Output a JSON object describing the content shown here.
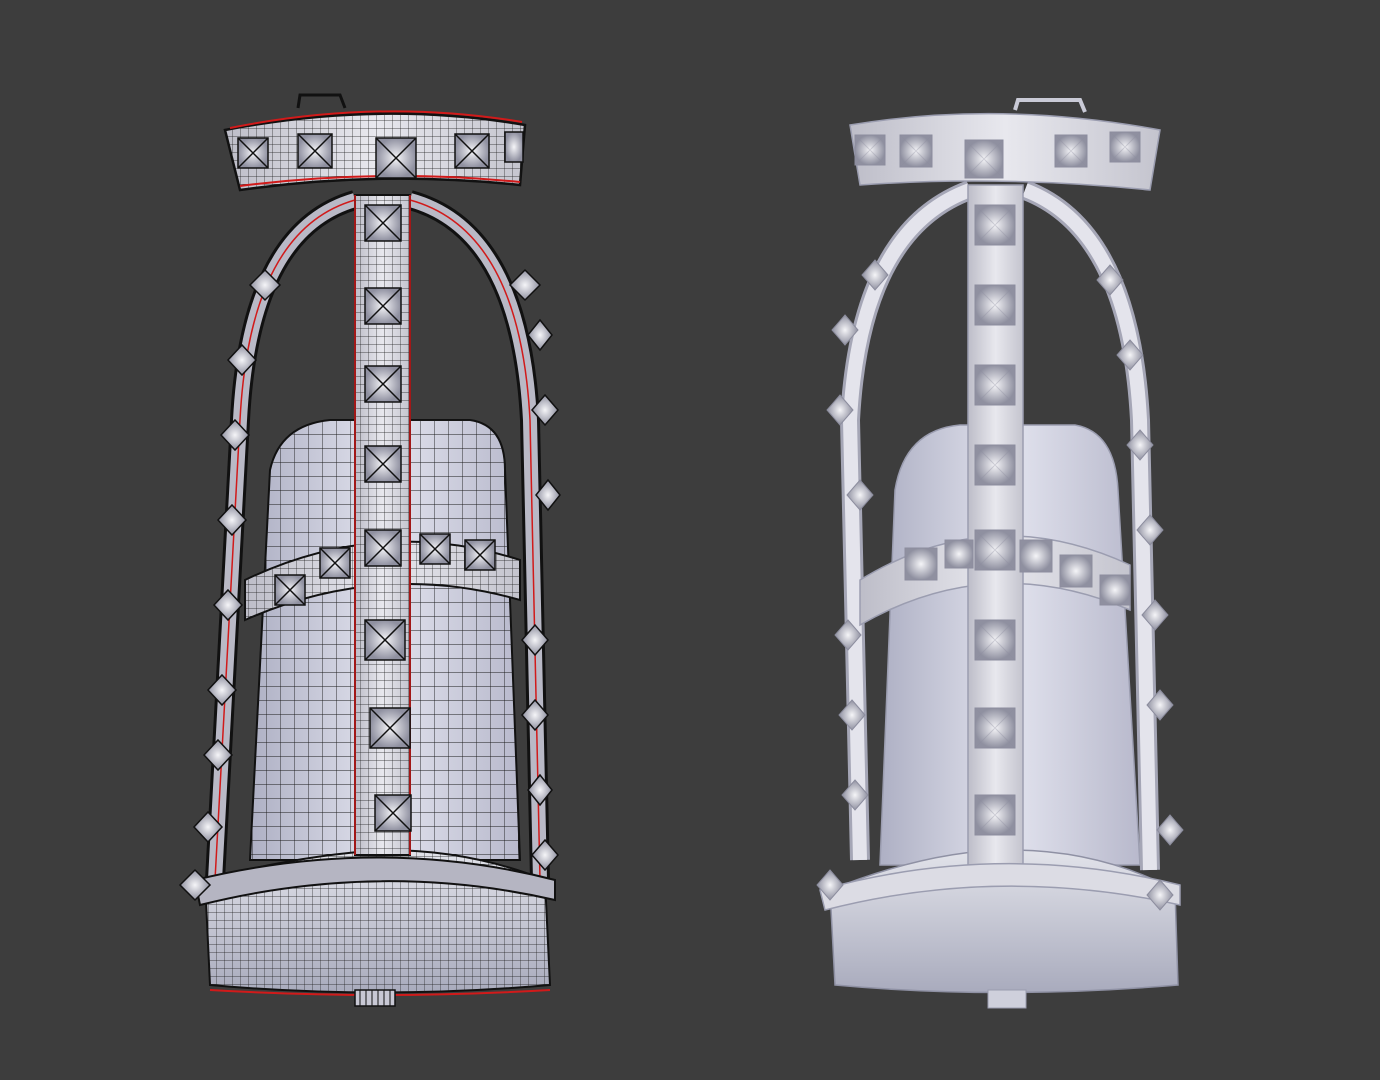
{
  "viewport": {
    "background": "#3d3d3d",
    "mode": "3d-viewport",
    "objects": [
      {
        "name": "shoe-wireframe",
        "display": "wireframe-overlay",
        "edge_color": "#111111",
        "seam_color": "#d11a1a",
        "surface_color": "#c9c9d6"
      },
      {
        "name": "shoe-solid",
        "display": "solid-shaded",
        "surface_color": "#dcdce6"
      }
    ]
  }
}
